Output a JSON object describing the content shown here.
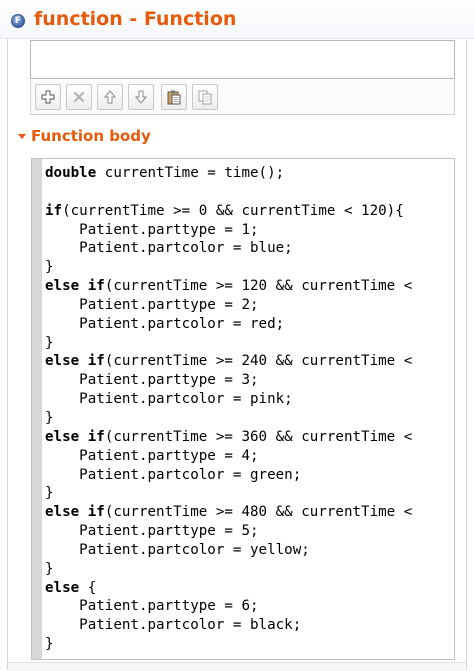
{
  "header": {
    "title": "function - Function"
  },
  "toolbar": {
    "buttons": [
      {
        "name": "add",
        "icon": "plus-icon"
      },
      {
        "name": "remove",
        "icon": "remove-icon"
      },
      {
        "name": "move-up",
        "icon": "arrow-up-icon"
      },
      {
        "name": "move-down",
        "icon": "arrow-down-icon"
      },
      {
        "name": "paste",
        "icon": "paste-icon"
      },
      {
        "name": "copy",
        "icon": "copy-icon"
      }
    ]
  },
  "section": {
    "title": "Function body"
  },
  "code": {
    "lines": [
      [
        {
          "t": "double",
          "kw": true
        },
        {
          "t": " currentTime = time();"
        }
      ],
      [],
      [
        {
          "t": "if",
          "kw": true
        },
        {
          "t": "(currentTime >= 0 && currentTime < 120){"
        }
      ],
      [
        {
          "t": "    Patient.parttype = 1;"
        }
      ],
      [
        {
          "t": "    Patient.partcolor = blue;"
        }
      ],
      [
        {
          "t": "}"
        }
      ],
      [
        {
          "t": "else",
          "kw": true
        },
        {
          "t": " "
        },
        {
          "t": "if",
          "kw": true
        },
        {
          "t": "(currentTime >= 120 && currentTime <"
        }
      ],
      [
        {
          "t": "    Patient.parttype = 2;"
        }
      ],
      [
        {
          "t": "    Patient.partcolor = red;"
        }
      ],
      [
        {
          "t": "}"
        }
      ],
      [
        {
          "t": "else",
          "kw": true
        },
        {
          "t": " "
        },
        {
          "t": "if",
          "kw": true
        },
        {
          "t": "(currentTime >= 240 && currentTime <"
        }
      ],
      [
        {
          "t": "    Patient.parttype = 3;"
        }
      ],
      [
        {
          "t": "    Patient.partcolor = pink;"
        }
      ],
      [
        {
          "t": "}"
        }
      ],
      [
        {
          "t": "else",
          "kw": true
        },
        {
          "t": " "
        },
        {
          "t": "if",
          "kw": true
        },
        {
          "t": "(currentTime >= 360 && currentTime <"
        }
      ],
      [
        {
          "t": "    Patient.parttype = 4;"
        }
      ],
      [
        {
          "t": "    Patient.partcolor = green;"
        }
      ],
      [
        {
          "t": "}"
        }
      ],
      [
        {
          "t": "else",
          "kw": true
        },
        {
          "t": " "
        },
        {
          "t": "if",
          "kw": true
        },
        {
          "t": "(currentTime >= 480 && currentTime <"
        }
      ],
      [
        {
          "t": "    Patient.parttype = 5;"
        }
      ],
      [
        {
          "t": "    Patient.partcolor = yellow;"
        }
      ],
      [
        {
          "t": "}"
        }
      ],
      [
        {
          "t": "else",
          "kw": true
        },
        {
          "t": " {"
        }
      ],
      [
        {
          "t": "    Patient.parttype = 6;"
        }
      ],
      [
        {
          "t": "    Patient.partcolor = black;"
        }
      ],
      [
        {
          "t": "}"
        }
      ]
    ]
  },
  "colors": {
    "accent": "#e65a0b",
    "gutter": "#d7d7d7"
  }
}
